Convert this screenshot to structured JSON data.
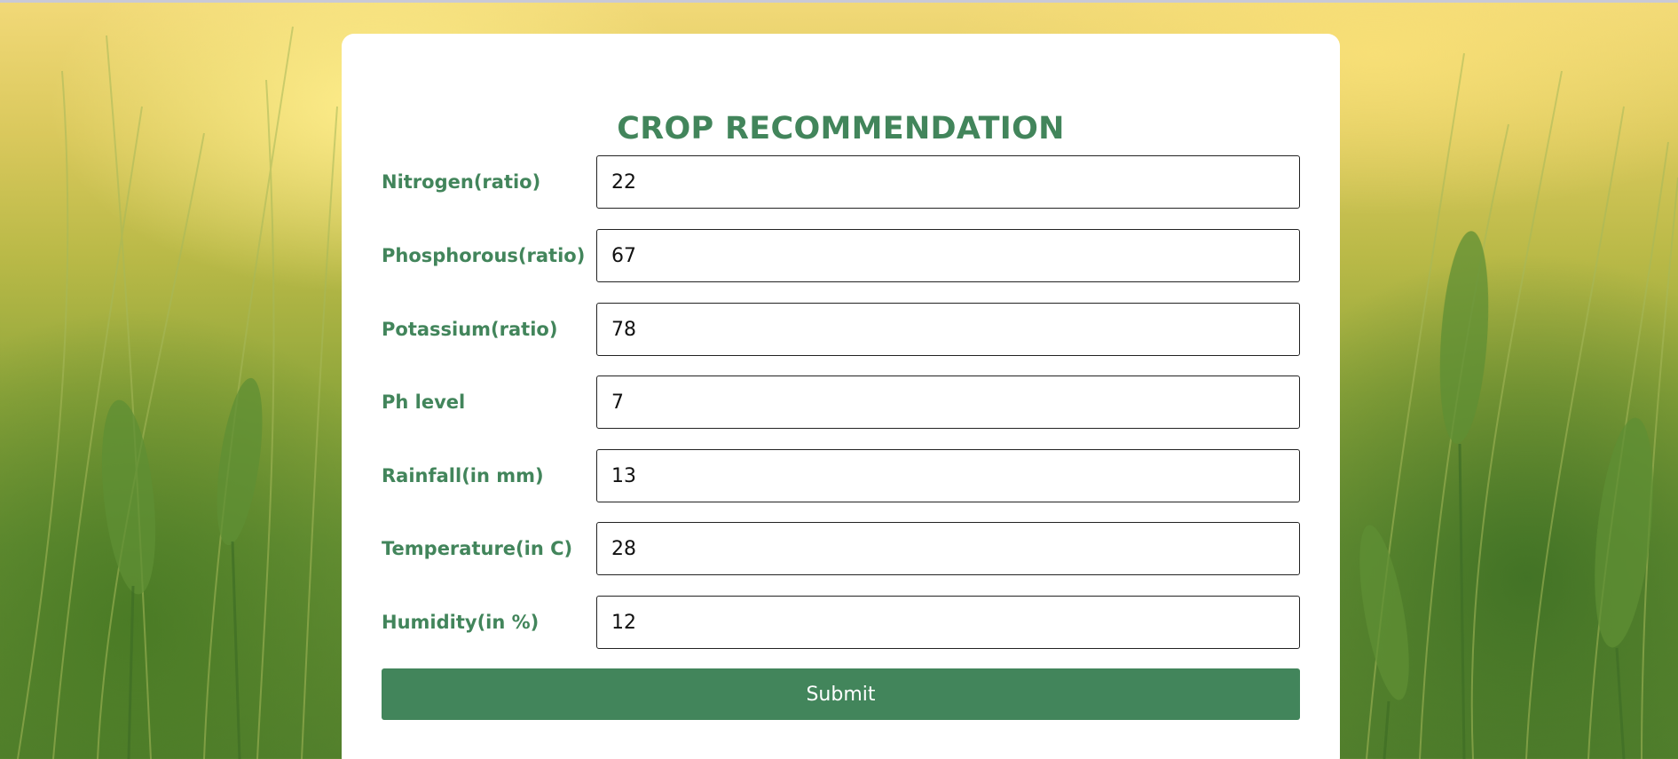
{
  "page": {
    "title": "CROP RECOMMENDATION",
    "accent_color": "#42855b",
    "background": "wheat-field-photo"
  },
  "form": {
    "fields": [
      {
        "label": "Nitrogen(ratio)",
        "value": "22"
      },
      {
        "label": "Phosphorous(ratio)",
        "value": "67"
      },
      {
        "label": "Potassium(ratio)",
        "value": "78"
      },
      {
        "label": "Ph level",
        "value": "7"
      },
      {
        "label": "Rainfall(in mm)",
        "value": "13"
      },
      {
        "label": "Temperature(in C)",
        "value": "28"
      },
      {
        "label": "Humidity(in %)",
        "value": "12"
      }
    ],
    "submit_label": "Submit"
  }
}
